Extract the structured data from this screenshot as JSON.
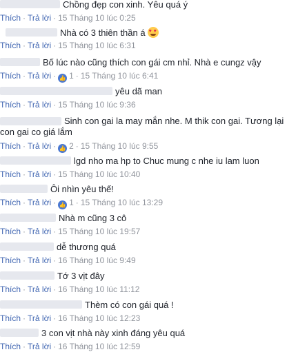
{
  "actions": {
    "like": "Thích",
    "reply": "Trả lời",
    "sep": "·"
  },
  "colors": {
    "link": "#4267b2",
    "meta": "#90949c",
    "text": "#1d2129",
    "like_badge": "#4a78d1"
  },
  "comments": [
    {
      "text": "Chồng đẹp con xinh. Yêu quá ý",
      "time": "15 Tháng 10 lúc 0:25"
    },
    {
      "text": "Nhà có 3 thiên thần á",
      "emoji": "heart-eyes-emoji",
      "time": "15 Tháng 10 lúc 6:31"
    },
    {
      "text": "Bố lúc nào cũng thích con gái cm nhỉ. Nhà e cungz vậy",
      "likes": "1",
      "time": "15 Tháng 10 lúc 6:41"
    },
    {
      "text": "yêu dã man",
      "time": "15 Tháng 10 lúc 9:36"
    },
    {
      "text": "Sinh con gai la may mắn nhe. M thik con gai. Tương lại con gai co giá lắm",
      "likes": "2",
      "time": "15 Tháng 10 lúc 9:55"
    },
    {
      "text": "lgd nho ma hp to Chuc mung c nhe iu lam luon",
      "time": "15 Tháng 10 lúc 10:40"
    },
    {
      "text": "Ôi nhìn yêu thế!",
      "likes": "1",
      "time": "15 Tháng 10 lúc 13:29"
    },
    {
      "text": "Nhà m cũng 3 cô",
      "time": "15 Tháng 10 lúc 19:57"
    },
    {
      "text": "dễ thương quá",
      "time": "16 Tháng 10 lúc 9:49"
    },
    {
      "text": "Tớ 3 vịt đây",
      "time": "16 Tháng 10 lúc 11:12"
    },
    {
      "text": "Thèm có con gái quá !",
      "time": "16 Tháng 10 lúc 12:23"
    },
    {
      "text": "3 con vịt nhà này xinh đáng yêu quá",
      "time": "16 Tháng 10 lúc 12:59"
    }
  ]
}
